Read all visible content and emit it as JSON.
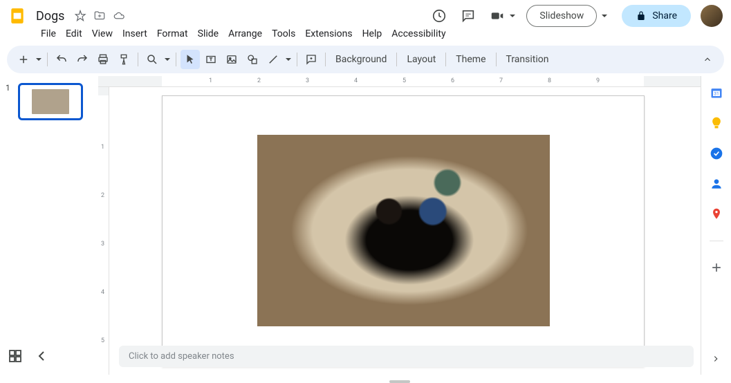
{
  "doc": {
    "title": "Dogs"
  },
  "menus": [
    "File",
    "Edit",
    "View",
    "Insert",
    "Format",
    "Slide",
    "Arrange",
    "Tools",
    "Extensions",
    "Help",
    "Accessibility"
  ],
  "toolbar": {
    "background": "Background",
    "layout": "Layout",
    "theme": "Theme",
    "transition": "Transition"
  },
  "header": {
    "slideshow": "Slideshow",
    "share": "Share"
  },
  "ruler_h": [
    "1",
    "2",
    "3",
    "4",
    "5",
    "6",
    "7",
    "8",
    "9"
  ],
  "ruler_v": [
    "1",
    "2",
    "3",
    "4",
    "5"
  ],
  "slides": [
    {
      "number": "1",
      "selected": true
    }
  ],
  "speaker_notes_placeholder": "Click to add speaker notes"
}
